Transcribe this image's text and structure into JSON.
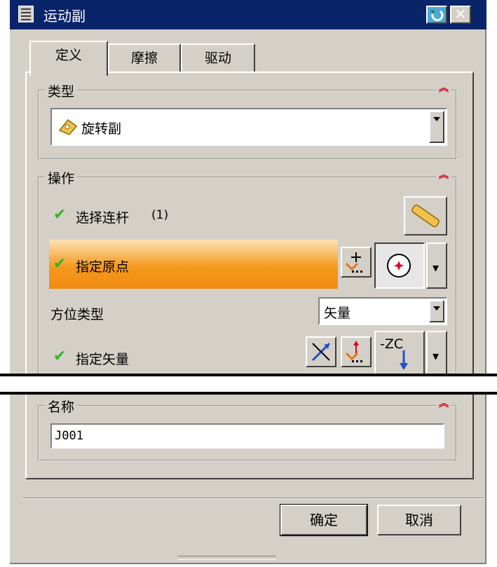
{
  "window": {
    "title": "运动副"
  },
  "tabs": [
    {
      "label": "定义"
    },
    {
      "label": "摩擦"
    },
    {
      "label": "驱动"
    }
  ],
  "type_group": {
    "label": "类型",
    "selected": "旋转副"
  },
  "operation_group": {
    "label": "操作",
    "select_link": {
      "label": "选择连杆",
      "count": "(1)"
    },
    "specify_origin": {
      "label": "指定原点"
    },
    "orientation": {
      "label": "方位类型",
      "selected": "矢量"
    },
    "specify_vector": {
      "label": "指定矢量",
      "vector_label": "-ZC"
    }
  },
  "name_group": {
    "label": "名称",
    "value": "J001"
  },
  "buttons": {
    "ok": "确定",
    "cancel": "取消"
  },
  "colors": {
    "title_bar": "#0a246a",
    "highlight": "#f59a1e",
    "check": "#2fb52f",
    "collapse_arrow": "#e0001b"
  }
}
